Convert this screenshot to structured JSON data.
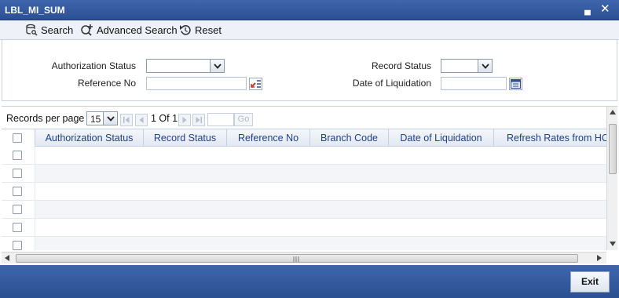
{
  "window": {
    "title": "LBL_MI_SUM",
    "minimize_glyph": "▄",
    "close_glyph": "✕"
  },
  "toolbar": {
    "search_label": "Search",
    "advanced_search_label": "Advanced Search",
    "reset_label": "Reset"
  },
  "form": {
    "authorization_status_label": "Authorization Status",
    "authorization_status_value": "",
    "record_status_label": "Record Status",
    "record_status_value": "",
    "reference_no_label": "Reference No",
    "reference_no_value": "",
    "date_of_liquidation_label": "Date of Liquidation",
    "date_of_liquidation_value": ""
  },
  "pager": {
    "records_per_page_label": "Records per page",
    "records_per_page_value": "15",
    "page_info": "1 Of 1",
    "go_label": "Go"
  },
  "grid": {
    "columns": [
      "Authorization Status",
      "Record Status",
      "Reference No",
      "Branch Code",
      "Date of Liquidation",
      "Refresh Rates from HO"
    ],
    "row_count": 6
  },
  "footer": {
    "exit_label": "Exit"
  },
  "colors": {
    "titlebar": "#2c4f92",
    "header_text": "#1f3f8a"
  }
}
